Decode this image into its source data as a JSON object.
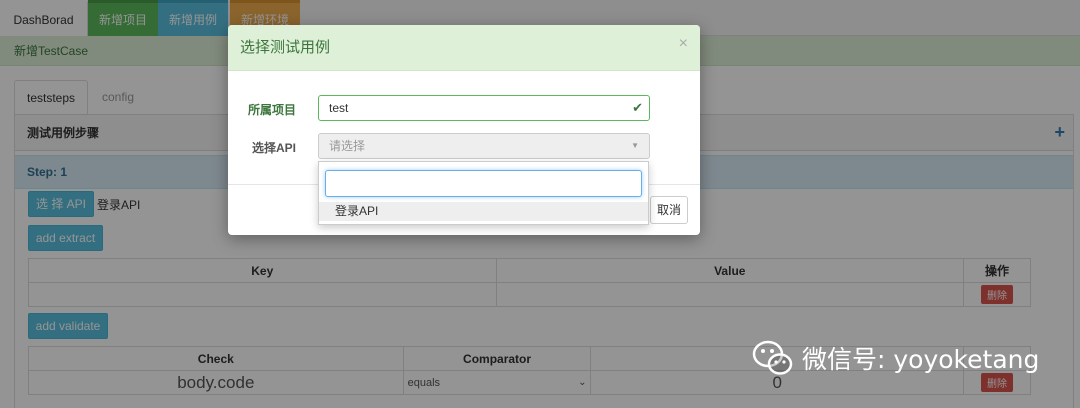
{
  "topnav": {
    "dashboard": "DashBorad",
    "new_project": "新增项目",
    "new_case": "新增用例",
    "new_env": "新增环境"
  },
  "alert": {
    "text": "新增TestCase"
  },
  "subtabs": {
    "steps": "teststeps",
    "config": "config"
  },
  "panel": {
    "title": "测试用例步骤",
    "step_label": "Step: 1",
    "select_api_button": "选 择 API",
    "selected_api": "登录API",
    "add_extract_button": "add extract",
    "extract_table": {
      "headers": [
        "Key",
        "Value",
        "操作"
      ],
      "delete_label": "删除"
    },
    "add_validate_button": "add validate",
    "validate_table": {
      "headers": [
        "Check",
        "Comparator",
        "",
        ""
      ],
      "row": {
        "check": "body.code",
        "comparator": "equals",
        "expected": "0",
        "delete_label": "删除"
      }
    }
  },
  "modal": {
    "title": "选择测试用例",
    "project_label": "所属项目",
    "project_value": "test",
    "api_label": "选择API",
    "api_placeholder": "请选择",
    "cancel_button": "取消"
  },
  "dropdown": {
    "search_value": "",
    "options": [
      "登录API"
    ]
  },
  "watermark": {
    "text": "微信号: yoyoketang"
  },
  "colors": {
    "success": "#5cb85c",
    "info": "#5bc0de",
    "warning": "#f0ad4e",
    "danger": "#d9534f"
  },
  "icons": [
    "plus-icon",
    "close-icon",
    "check-icon",
    "caret-down-icon",
    "chevron-down-icon",
    "wechat-icon"
  ]
}
